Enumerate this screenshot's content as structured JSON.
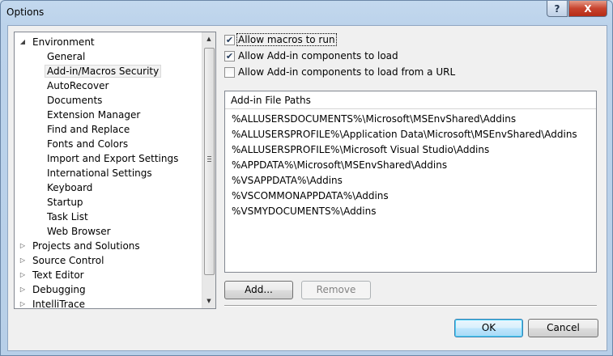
{
  "window": {
    "title": "Options",
    "help_label": "?",
    "close_label": "X"
  },
  "tree": {
    "items": [
      {
        "label": "Environment",
        "level": 0,
        "expander": "expanded"
      },
      {
        "label": "General",
        "level": 1
      },
      {
        "label": "Add-in/Macros Security",
        "level": 1,
        "selected": true
      },
      {
        "label": "AutoRecover",
        "level": 1
      },
      {
        "label": "Documents",
        "level": 1
      },
      {
        "label": "Extension Manager",
        "level": 1
      },
      {
        "label": "Find and Replace",
        "level": 1
      },
      {
        "label": "Fonts and Colors",
        "level": 1
      },
      {
        "label": "Import and Export Settings",
        "level": 1
      },
      {
        "label": "International Settings",
        "level": 1
      },
      {
        "label": "Keyboard",
        "level": 1
      },
      {
        "label": "Startup",
        "level": 1
      },
      {
        "label": "Task List",
        "level": 1
      },
      {
        "label": "Web Browser",
        "level": 1
      },
      {
        "label": "Projects and Solutions",
        "level": 0,
        "expander": "collapsed"
      },
      {
        "label": "Source Control",
        "level": 0,
        "expander": "collapsed"
      },
      {
        "label": "Text Editor",
        "level": 0,
        "expander": "collapsed"
      },
      {
        "label": "Debugging",
        "level": 0,
        "expander": "collapsed"
      },
      {
        "label": "IntelliTrace",
        "level": 0,
        "expander": "collapsed"
      }
    ]
  },
  "options": {
    "allow_macros": {
      "label": "Allow macros to run",
      "checked": true
    },
    "allow_addins": {
      "label": "Allow Add-in components to load",
      "checked": true
    },
    "allow_url": {
      "label": "Allow Add-in components to load from a URL",
      "checked": false
    }
  },
  "paths": {
    "header": "Add-in File Paths",
    "items": [
      "%ALLUSERSDOCUMENTS%\\Microsoft\\MSEnvShared\\Addins",
      "%ALLUSERSPROFILE%\\Application Data\\Microsoft\\MSEnvShared\\Addins",
      "%ALLUSERSPROFILE%\\Microsoft Visual Studio\\Addins",
      "%APPDATA%\\Microsoft\\MSEnvShared\\Addins",
      "%VSAPPDATA%\\Addins",
      "%VSCOMMONAPPDATA%\\Addins",
      "%VSMYDOCUMENTS%\\Addins"
    ]
  },
  "buttons": {
    "add": "Add...",
    "remove": "Remove",
    "ok": "OK",
    "cancel": "Cancel"
  },
  "colors": {
    "selection_bg": "#f2f2f2",
    "checkmark": "#243b5c",
    "default_button_border": "#3c7fb1"
  }
}
